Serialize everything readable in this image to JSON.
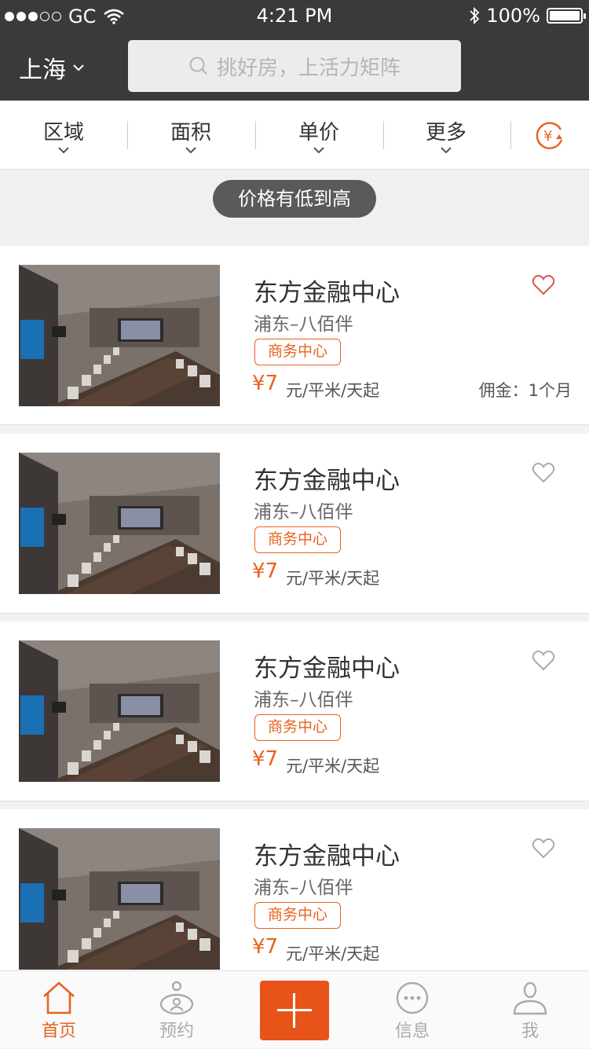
{
  "status_bar": {
    "carrier": "GC",
    "time": "4:21 PM",
    "battery": "100%"
  },
  "header": {
    "city": "上海",
    "search_placeholder": "挑好房，上活力矩阵"
  },
  "filters": [
    {
      "label": "区域"
    },
    {
      "label": "面积"
    },
    {
      "label": "单价"
    },
    {
      "label": "更多"
    }
  ],
  "sort": {
    "label": "价格有低到高"
  },
  "listings": [
    {
      "name": "东方金融中心",
      "area": "浦东–八佰伴",
      "tag": "商务中心",
      "price": "¥7",
      "unit": "元/平米/天起",
      "commission": "佣金：1个月",
      "favorited": true
    },
    {
      "name": "东方金融中心",
      "area": "浦东–八佰伴",
      "tag": "商务中心",
      "price": "¥7",
      "unit": "元/平米/天起",
      "commission": "",
      "favorited": false
    },
    {
      "name": "东方金融中心",
      "area": "浦东–八佰伴",
      "tag": "商务中心",
      "price": "¥7",
      "unit": "元/平米/天起",
      "commission": "",
      "favorited": false
    },
    {
      "name": "东方金融中心",
      "area": "浦东–八佰伴",
      "tag": "商务中心",
      "price": "¥7",
      "unit": "元/平米/天起",
      "commission": "",
      "favorited": false
    }
  ],
  "tabbar": {
    "home": "首页",
    "booking": "预约",
    "messages": "信息",
    "me": "我"
  },
  "colors": {
    "accent": "#e8621e",
    "header_bg": "#3a3a3a"
  }
}
